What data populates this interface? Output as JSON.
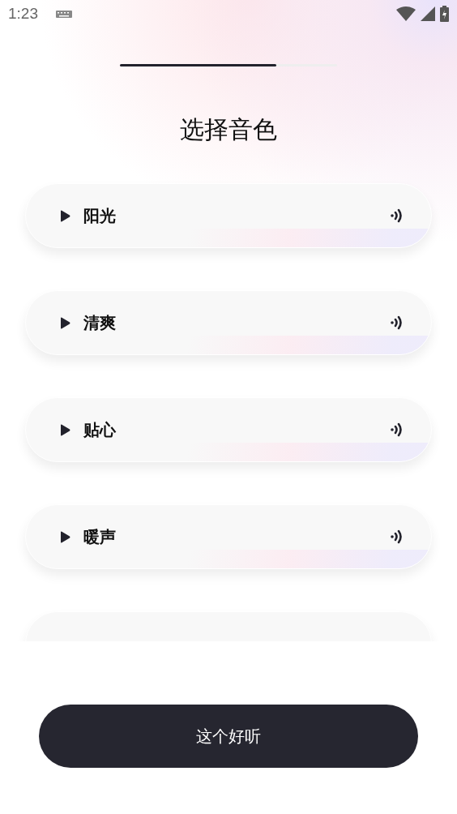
{
  "status_bar": {
    "time": "1:23"
  },
  "progress": {
    "level": 0.72
  },
  "title": "选择音色",
  "voices": [
    {
      "label": "阳光"
    },
    {
      "label": "清爽"
    },
    {
      "label": "贴心"
    },
    {
      "label": "暖声"
    },
    {
      "kind": "cut"
    }
  ],
  "confirm_button": "这个好听"
}
